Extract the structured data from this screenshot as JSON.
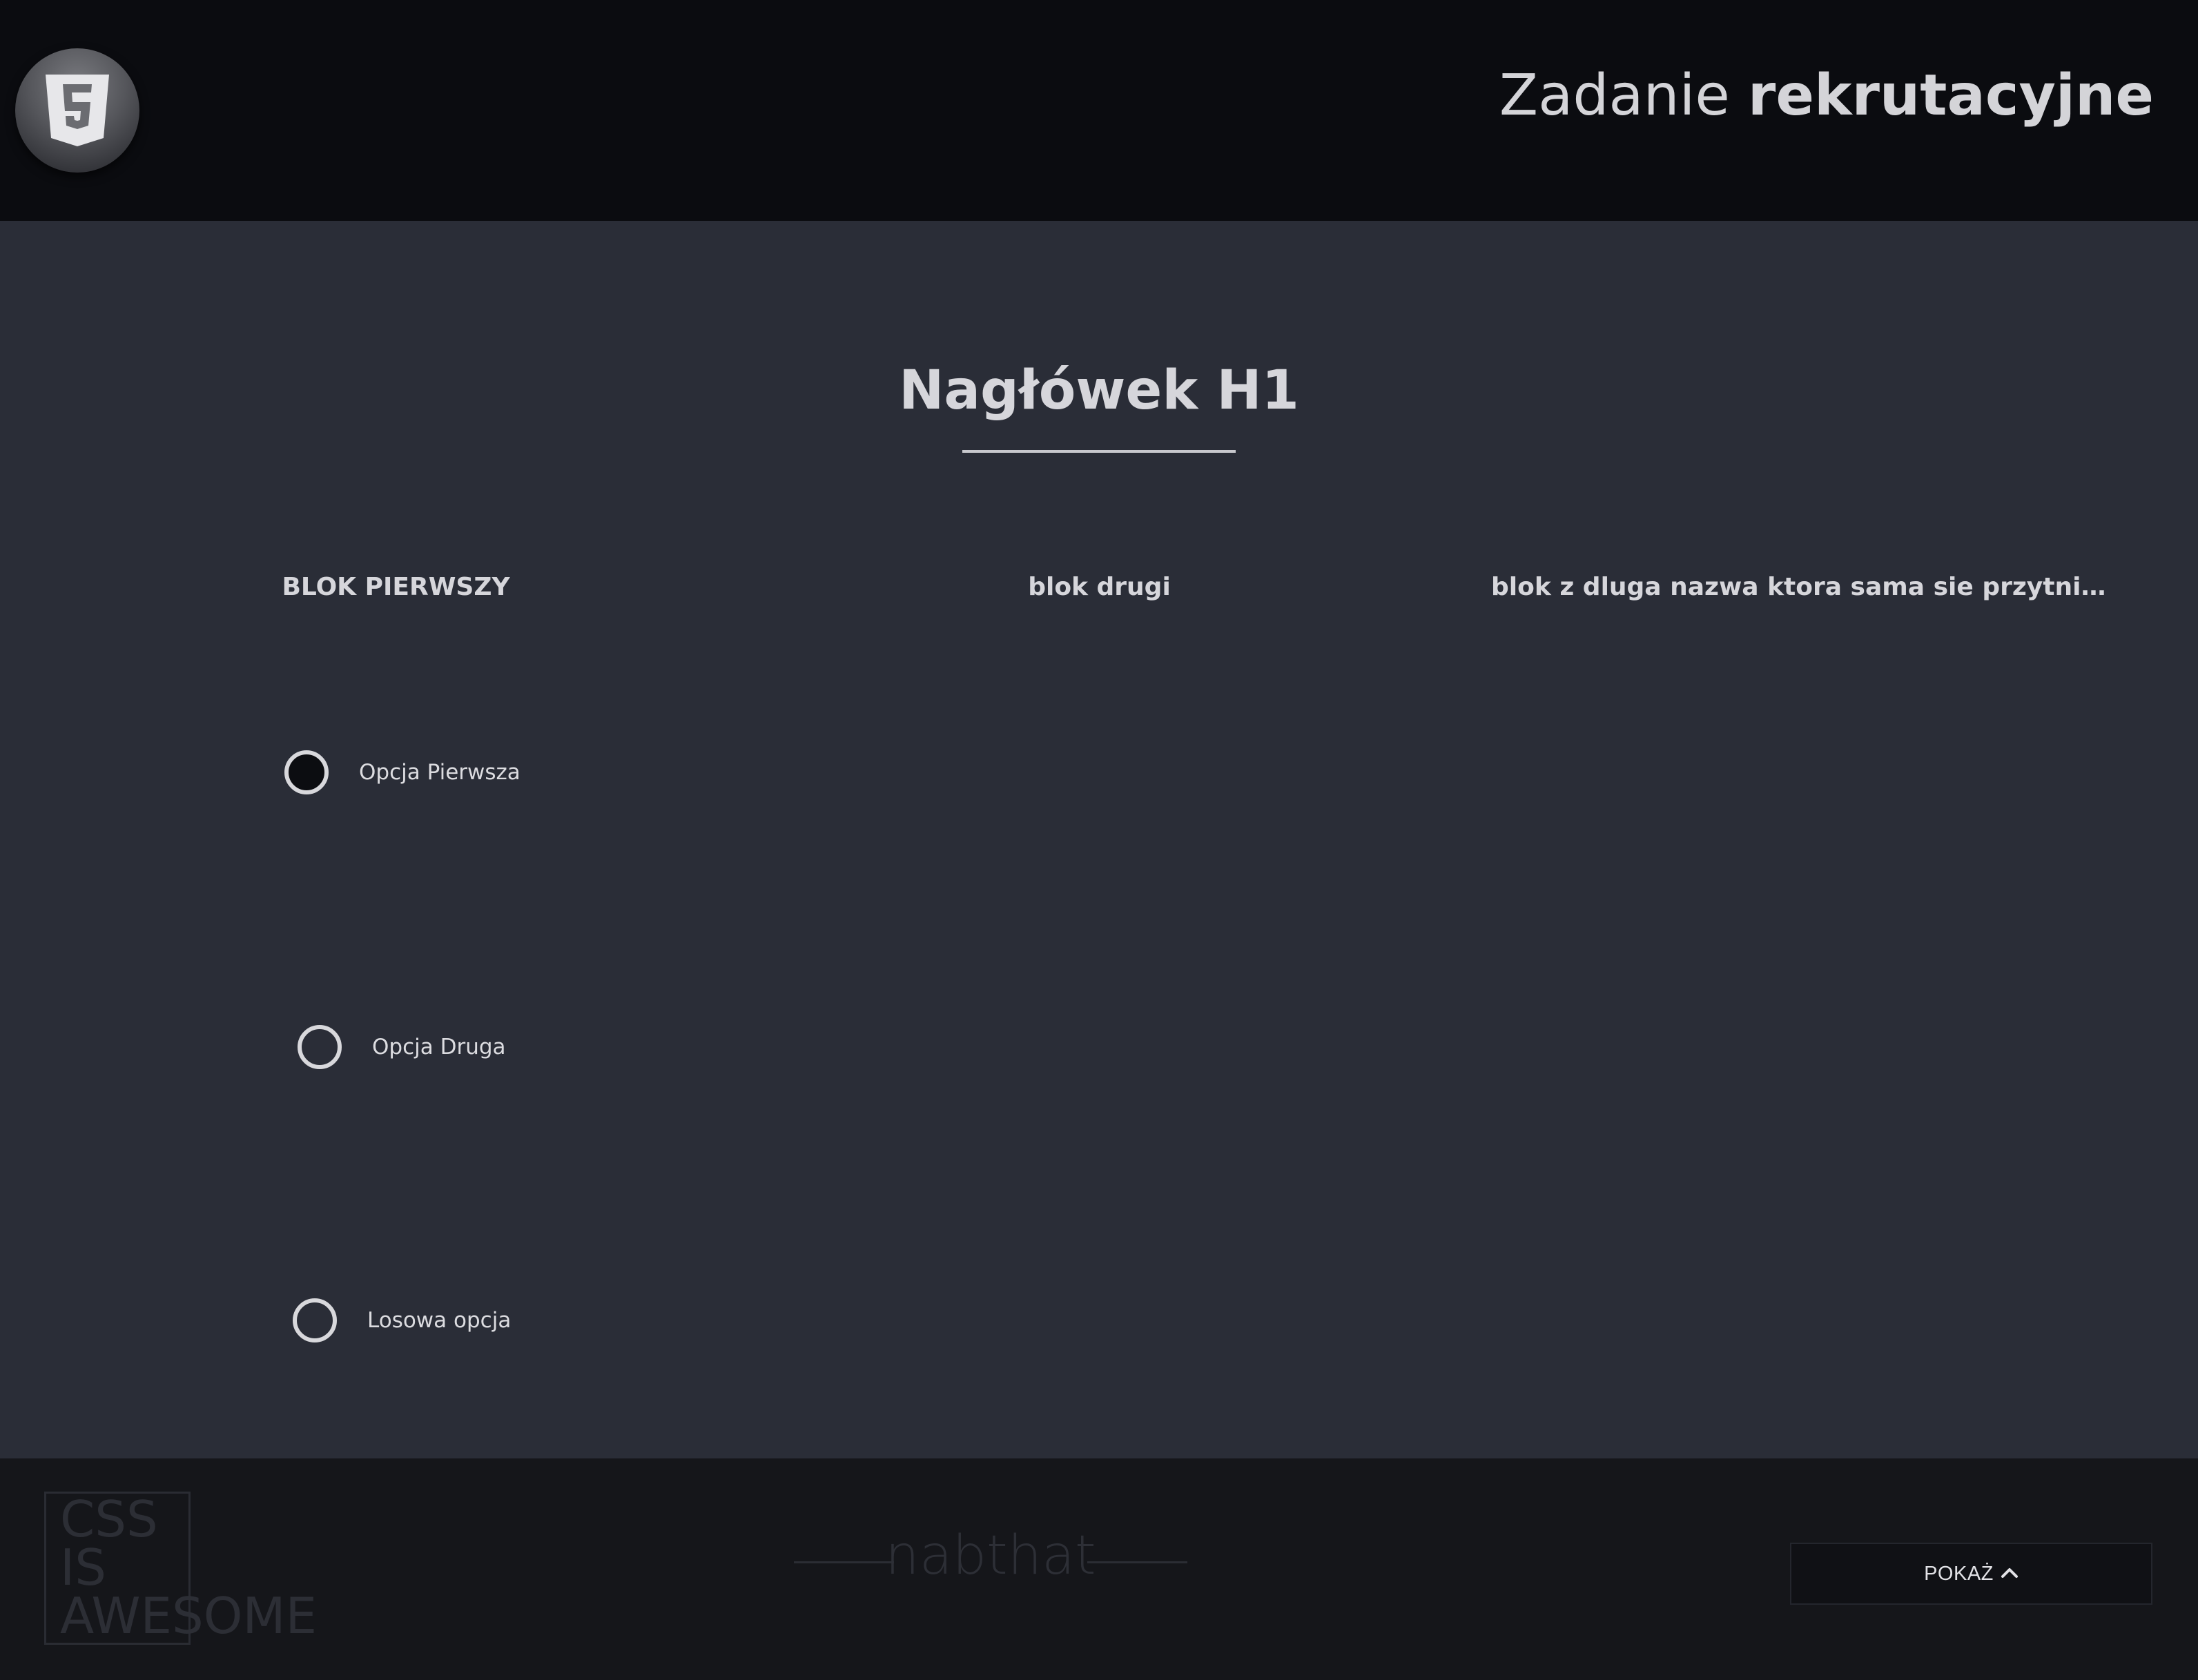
{
  "header": {
    "logo_icon": "html5-icon",
    "title_light": "Zadanie ",
    "title_bold": "rekrutacyjne"
  },
  "main": {
    "heading": "Nagłówek H1",
    "tabs": [
      {
        "label": "BLOK PIERWSZY"
      },
      {
        "label": "blok drugi"
      },
      {
        "label": "blok z dluga nazwa ktora sama sie przytnie..."
      }
    ],
    "options": [
      {
        "label": "Opcja Pierwsza",
        "checked": true
      },
      {
        "label": "Opcja Druga",
        "checked": false
      },
      {
        "label": "Losowa opcja",
        "checked": false
      }
    ]
  },
  "footer": {
    "badge_text": "CSS\nIS\nAWESOME",
    "author": "nabthat",
    "show_button_label": "POKAŻ",
    "show_button_icon": "chevron-up-icon"
  },
  "colors": {
    "header_bg": "#0b0c10",
    "main_bg": "#2a2d37",
    "footer_bg": "#15161a",
    "text_light": "#d6d6db"
  }
}
